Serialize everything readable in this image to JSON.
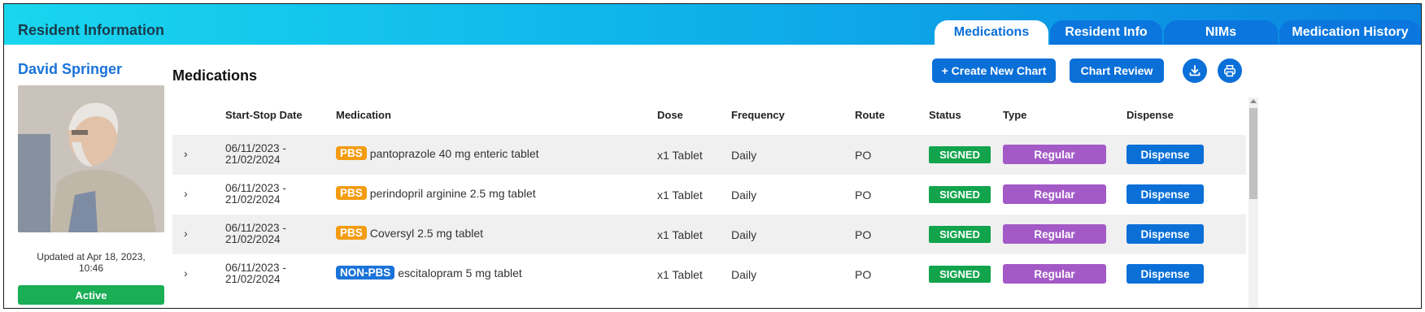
{
  "header": {
    "title": "Resident Information",
    "tabs": [
      {
        "label": "Medications",
        "active": true
      },
      {
        "label": "Resident Info",
        "active": false
      },
      {
        "label": "NIMs",
        "active": false
      },
      {
        "label": "Medication History",
        "active": false
      }
    ]
  },
  "resident": {
    "name": "David Springer",
    "updated_line1": "Updated at Apr 18, 2023,",
    "updated_line2": "10:46",
    "status": "Active"
  },
  "main": {
    "title": "Medications",
    "create_button": "+ Create New Chart",
    "review_button": "Chart Review",
    "download_icon": "download-icon",
    "print_icon": "printer-icon"
  },
  "table": {
    "headers": {
      "date": "Start-Stop Date",
      "medication": "Medication",
      "dose": "Dose",
      "frequency": "Frequency",
      "route": "Route",
      "status": "Status",
      "type": "Type",
      "dispense": "Dispense"
    },
    "rows": [
      {
        "date_line1": "06/11/2023 -",
        "date_line2": "21/02/2024",
        "badge": "PBS",
        "medication": "pantoprazole 40 mg enteric tablet",
        "dose": "x1 Tablet",
        "frequency": "Daily",
        "route": "PO",
        "status": "SIGNED",
        "type": "Regular",
        "dispense": "Dispense"
      },
      {
        "date_line1": "06/11/2023 -",
        "date_line2": "21/02/2024",
        "badge": "PBS",
        "medication": "perindopril arginine 2.5 mg tablet",
        "dose": "x1 Tablet",
        "frequency": "Daily",
        "route": "PO",
        "status": "SIGNED",
        "type": "Regular",
        "dispense": "Dispense"
      },
      {
        "date_line1": "06/11/2023 -",
        "date_line2": "21/02/2024",
        "badge": "PBS",
        "medication": "Coversyl 2.5 mg tablet",
        "dose": "x1 Tablet",
        "frequency": "Daily",
        "route": "PO",
        "status": "SIGNED",
        "type": "Regular",
        "dispense": "Dispense"
      },
      {
        "date_line1": "06/11/2023 -",
        "date_line2": "21/02/2024",
        "badge": "NON-PBS",
        "medication": "escitalopram 5 mg tablet",
        "dose": "x1 Tablet",
        "frequency": "Daily",
        "route": "PO",
        "status": "SIGNED",
        "type": "Regular",
        "dispense": "Dispense"
      }
    ]
  },
  "colors": {
    "accent": "#0b6fd8",
    "pbs": "#f39c12",
    "non_pbs": "#1a73d9",
    "signed": "#11a44c",
    "regular": "#a35ac6",
    "active": "#1aae55"
  }
}
